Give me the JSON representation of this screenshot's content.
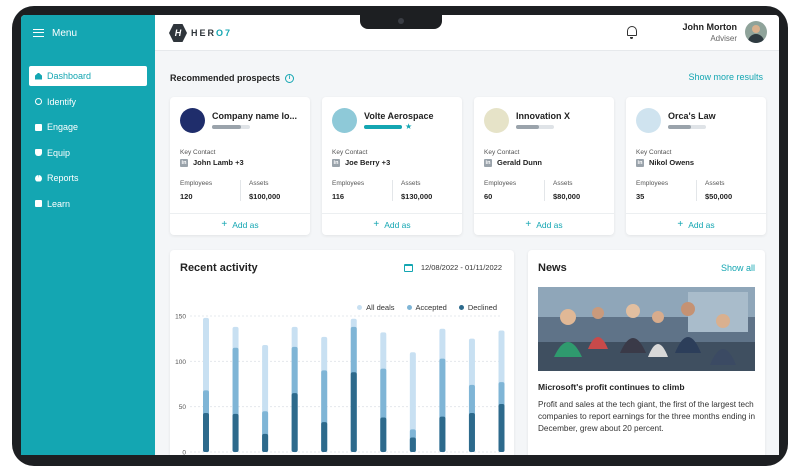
{
  "sidebar": {
    "menu_label": "Menu",
    "items": [
      {
        "label": "Dashboard",
        "icon": "home-icon",
        "active": true
      },
      {
        "label": "Identify",
        "icon": "search-icon",
        "active": false
      },
      {
        "label": "Engage",
        "icon": "briefcase-icon",
        "active": false
      },
      {
        "label": "Equip",
        "icon": "toolkit-icon",
        "active": false
      },
      {
        "label": "Reports",
        "icon": "pie-chart-icon",
        "active": false
      },
      {
        "label": "Learn",
        "icon": "video-icon",
        "active": false
      }
    ]
  },
  "header": {
    "logo_text_a": "HER",
    "logo_text_b": "O7",
    "user_name": "John Morton",
    "user_role": "Adviser"
  },
  "prospects": {
    "title": "Recommended prospects",
    "show_more": "Show more results",
    "key_contact_label": "Key Contact",
    "employees_label": "Employees",
    "assets_label": "Assets",
    "add_label": "Add as",
    "cards": [
      {
        "name": "Company name lo...",
        "contact": "John Lamb +3",
        "employees": "120",
        "assets": "$100,000",
        "level": 0.75,
        "accent": "#1f2d6b"
      },
      {
        "name": "Volte Aerospace",
        "contact": "Joe Berry +3",
        "employees": "116",
        "assets": "$130,000",
        "level": 1.0,
        "accent": "#8ec9d8"
      },
      {
        "name": "Innovation X",
        "contact": "Gerald Dunn",
        "employees": "60",
        "assets": "$80,000",
        "level": 0.6,
        "accent": "#e6e3c8"
      },
      {
        "name": "Orca's Law",
        "contact": "Nikol Owens",
        "employees": "35",
        "assets": "$50,000",
        "level": 0.6,
        "accent": "#cfe3ef"
      }
    ]
  },
  "activity": {
    "title": "Recent activity",
    "date_range": "12/08/2022 - 01/11/2022",
    "colors": {
      "all": "#c8e0f2",
      "accepted": "#7fb5d6",
      "declined": "#2d6a8c"
    }
  },
  "chart_data": {
    "type": "bar",
    "legend": [
      "All deals",
      "Accepted",
      "Declined"
    ],
    "ylim": [
      0,
      150
    ],
    "yticks": [
      "150",
      "100",
      "50",
      "0"
    ],
    "series": [
      {
        "name": "All deals",
        "values": [
          148,
          138,
          118,
          138,
          127,
          147,
          132,
          110,
          136,
          125,
          134
        ]
      },
      {
        "name": "Accepted",
        "values": [
          68,
          115,
          45,
          116,
          90,
          138,
          92,
          25,
          103,
          74,
          77
        ]
      },
      {
        "name": "Declined",
        "values": [
          43,
          42,
          20,
          65,
          33,
          88,
          38,
          16,
          39,
          43,
          53
        ]
      }
    ]
  },
  "news": {
    "title": "News",
    "show_all": "Show all",
    "headline": "Microsoft's profit continues to climb",
    "body": "Profit and sales at the tech giant, the first of the largest tech companies to report earnings for the three months ending in December, grew about 20 percent."
  }
}
